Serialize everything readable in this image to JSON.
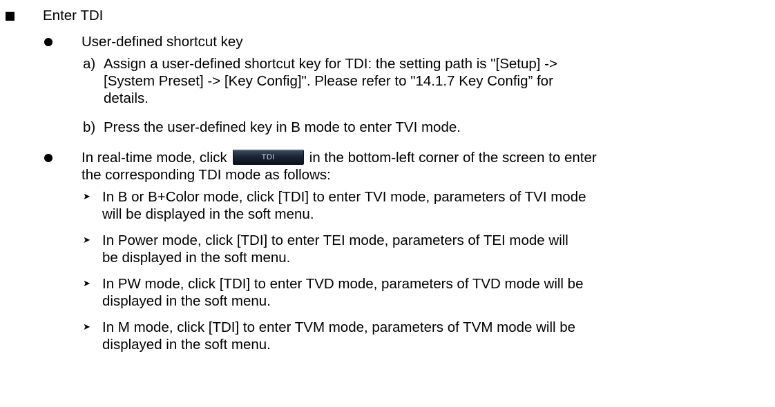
{
  "section": {
    "bullet_icon": "black-square-bullet",
    "title": "Enter TDI"
  },
  "shortcut": {
    "bullet_icon": "black-dot-bullet",
    "title": "User-defined shortcut key",
    "steps": [
      {
        "marker": "a)",
        "lines": [
          "Assign a user-defined shortcut key for TDI: the setting path is \"[Setup] ->",
          "[System Preset] -> [Key Config]\". Please refer to \"14.1.7 Key Config” for",
          "details."
        ]
      },
      {
        "marker": "b)",
        "lines": [
          "Press the user-defined key in B mode to enter TVI mode."
        ]
      }
    ]
  },
  "realtime": {
    "bullet_icon": "black-dot-bullet",
    "line1_before": "In real-time mode, click",
    "button_label": "TDI",
    "line1_after": "in the bottom-left corner of the screen to enter",
    "line2": "the corresponding TDI mode as follows:",
    "arrow_icon": "arrowhead-bullet",
    "items": [
      {
        "lines": [
          "In B or B+Color mode, click [TDI] to enter TVI mode, parameters of TVI mode",
          "will be displayed in the soft menu."
        ]
      },
      {
        "lines": [
          "In Power mode, click [TDI] to enter TEI mode, parameters of TEI mode will",
          "be displayed in the soft menu."
        ]
      },
      {
        "lines": [
          "In PW mode, click [TDI] to enter TVD mode, parameters of TVD mode will be",
          "displayed in the soft menu."
        ]
      },
      {
        "lines": [
          "In M mode, click [TDI] to enter TVM mode, parameters of TVM mode will be",
          "displayed in the soft menu."
        ]
      }
    ]
  }
}
